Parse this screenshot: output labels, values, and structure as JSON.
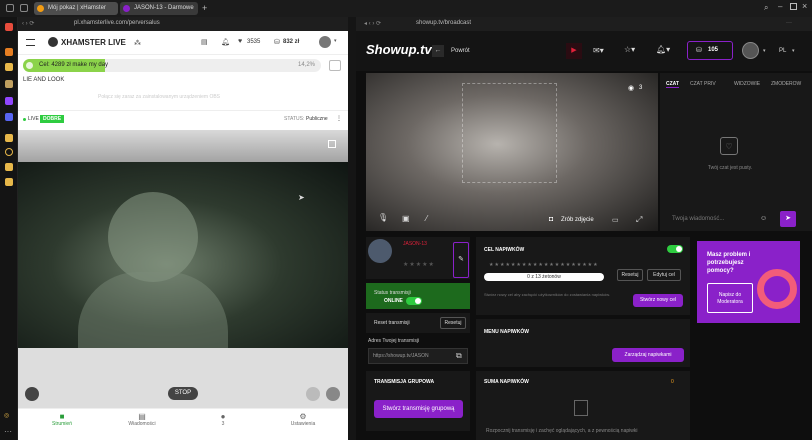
{
  "tabs": [
    {
      "label": "Mój pokaz | xHamster"
    },
    {
      "label": "JASON-13 - Darmowe"
    }
  ],
  "left": {
    "url": "pl.xhamsterlive.com/perversalus",
    "logo": "XHAMSTER LIVE",
    "stats": {
      "likes": "3535",
      "tokens": "832 zł"
    },
    "goal": {
      "text": "Cel: 4289 zł make my day",
      "percent": "14,2%",
      "progress": 0.142
    },
    "subtitle": "LIE AND LOOK",
    "notice": "Połącz się zaraz za zainstalowanym urządzeniem OBS",
    "live_label": "LIVE",
    "live_badge": "DOBRE",
    "status_label": "STATUS:",
    "status_value": "Publiczne",
    "stop_label": "STOP",
    "nav": [
      {
        "label": "Strumień"
      },
      {
        "label": "Wiadomości"
      },
      {
        "label": "3"
      },
      {
        "label": "Ustawienia"
      }
    ]
  },
  "right": {
    "url": "showup.tv/broadcast",
    "logo": "Showup.tv",
    "back_label": "Powrót",
    "tokens": "105",
    "lang": "PL",
    "chat_tabs": [
      {
        "label": "CZAT"
      },
      {
        "label": "CZAT PRIV"
      },
      {
        "label": "WIDZOWIE"
      },
      {
        "label": "ZMODEROW"
      }
    ],
    "viewers": "3",
    "photo_label": "Zrób zdjęcie",
    "chat_empty": "Twój czat jest pusty.",
    "chat_placeholder": "Twoja wiadomość...",
    "username": "JASON-13",
    "stars": "★★★★★",
    "status_title": "Status transmisji",
    "status_online": "ONLINE",
    "reset_title": "Reset transmisji",
    "reset_btn": "Resetuj",
    "address_title": "Adres Twojej transmisji",
    "address_value": "https://showup.tv/JASON",
    "group_title": "TRANSMISJA GRUPOWA",
    "group_btn": "Stwórz transmisję grupową",
    "goal_title": "CEL NAPIWKÓW",
    "goal_stars": "★★★★★★★★★★★★★★★★★★★★",
    "goal_progress": "0 z 13 żetonów",
    "goal_reset": "Resetuj",
    "goal_edit": "Edytuj cel",
    "goal_desc": "Stwórz nowy cel aby zachęcić użytkowników do zostawiania napiwków.",
    "goal_new": "Stwórz nowy cel",
    "menu_title": "MENU NAPIWKÓW",
    "menu_btn": "Zarządzaj napiwkami",
    "sum_title": "SUMA NAPIWKÓW",
    "sum_value": "0",
    "sum_desc": "Rozpocznij transmisję i zachęć oglądających, a z pewnością napiwki",
    "help_text": "Masz problem i potrzebujesz pomocy?",
    "help_btn": "Napisz do Moderatora"
  },
  "colors": {
    "purple": "#8a21c9",
    "green": "#2ecc40",
    "goal_green": "#8bd34a"
  }
}
